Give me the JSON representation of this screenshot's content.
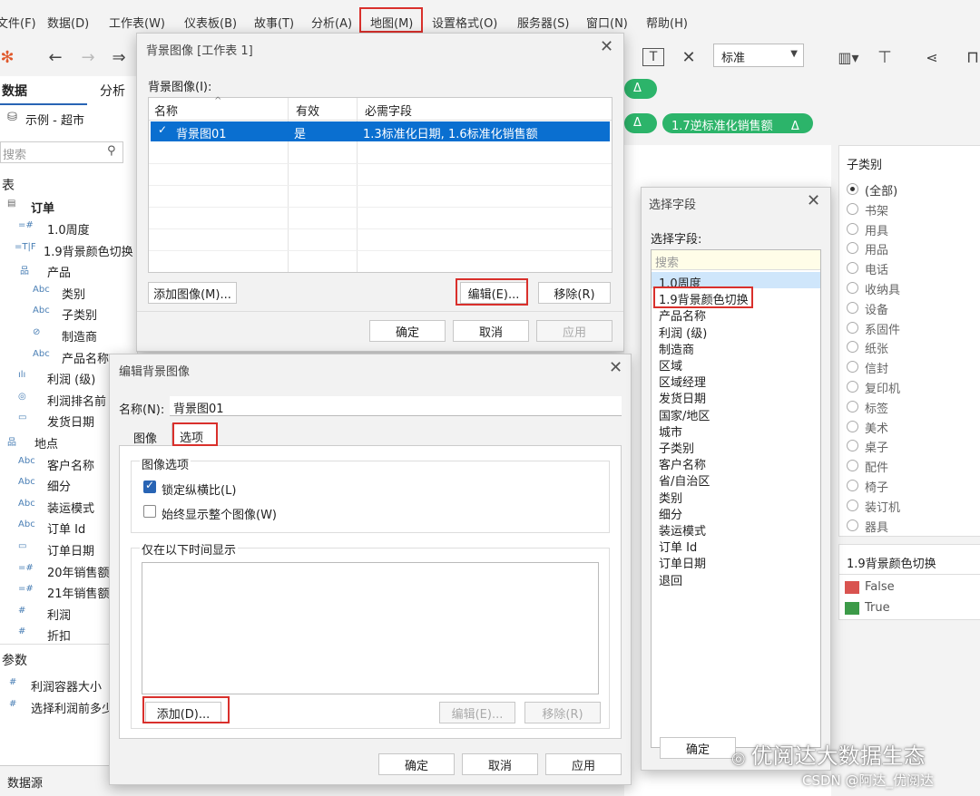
{
  "menu": [
    "文件(F)",
    "数据(D)",
    "工作表(W)",
    "仪表板(B)",
    "故事(T)",
    "分析(A)",
    "地图(M)",
    "设置格式(O)",
    "服务器(S)",
    "窗口(N)",
    "帮助(H)"
  ],
  "toolbar": {
    "select_value": "标准",
    "text_icon": "T"
  },
  "leftpane": {
    "tab_data": "数据",
    "tab_analysis": "分析",
    "datasource": "示例 - 超市",
    "search_placeholder": "搜索",
    "section_tables": "表",
    "table_name": "订单",
    "fields": [
      {
        "icon": "=#",
        "label": "1.0周度"
      },
      {
        "icon": "=T|F",
        "label": "1.9背景颜色切换"
      },
      {
        "icon": "品",
        "label": "产品"
      },
      {
        "icon": "Abc",
        "label": "类别"
      },
      {
        "icon": "Abc",
        "label": "子类别"
      },
      {
        "icon": "⊘",
        "label": "制造商"
      },
      {
        "icon": "Abc",
        "label": "产品名称"
      },
      {
        "icon": "ılı",
        "label": "利润 (级)"
      },
      {
        "icon": "◎",
        "label": "利润排名前"
      },
      {
        "icon": "▭",
        "label": "发货日期"
      },
      {
        "icon": "品",
        "label": "地点"
      },
      {
        "icon": "Abc",
        "label": "客户名称"
      },
      {
        "icon": "Abc",
        "label": "细分"
      },
      {
        "icon": "Abc",
        "label": "装运模式"
      },
      {
        "icon": "Abc",
        "label": "订单 Id"
      },
      {
        "icon": "▭",
        "label": "订单日期"
      },
      {
        "icon": "=#",
        "label": "20年销售额"
      },
      {
        "icon": "=#",
        "label": "21年销售额"
      },
      {
        "icon": "#",
        "label": "利润"
      },
      {
        "icon": "#",
        "label": "折扣"
      }
    ],
    "section_params": "参数",
    "params": [
      {
        "icon": "#",
        "label": "利润容器大小"
      },
      {
        "icon": "#",
        "label": "选择利润前多少"
      }
    ],
    "datasource_tab": "数据源"
  },
  "pills": {
    "pill1": "Δ",
    "pill2": "Δ",
    "pill3": "1.7逆标准化销售额",
    "pill3_delta": "Δ"
  },
  "subcat_panel": {
    "title": "子类别",
    "items": [
      "(全部)",
      "书架",
      "用具",
      "用品",
      "电话",
      "收纳具",
      "设备",
      "系固件",
      "纸张",
      "信封",
      "复印机",
      "标签",
      "美术",
      "桌子",
      "配件",
      "椅子",
      "装订机",
      "器具"
    ]
  },
  "color_panel": {
    "title": "1.9背景颜色切换",
    "items": [
      {
        "label": "False",
        "color": "#d9534f"
      },
      {
        "label": "True",
        "color": "#3c9a48"
      }
    ]
  },
  "bg_dialog": {
    "title": "背景图像 [工作表 1]",
    "list_label": "背景图像(I):",
    "col_name": "名称",
    "col_valid": "有效",
    "col_fields": "必需字段",
    "row": {
      "name": "背景图01",
      "valid": "是",
      "fields": "1.3标准化日期, 1.6标准化销售额"
    },
    "btn_add": "添加图像(M)...",
    "btn_edit": "编辑(E)...",
    "btn_remove": "移除(R)",
    "btn_ok": "确定",
    "btn_cancel": "取消",
    "btn_apply": "应用"
  },
  "edit_dialog": {
    "title": "编辑背景图像",
    "name_label": "名称(N):",
    "name_value": "背景图01",
    "tab_image": "图像",
    "tab_options": "选项",
    "group_image_options": "图像选项",
    "chk_lock": "锁定纵横比(L)",
    "chk_show_all": "始终显示整个图像(W)",
    "group_time": "仅在以下时间显示",
    "btn_add": "添加(D)...",
    "btn_edit": "编辑(E)...",
    "btn_remove": "移除(R)",
    "btn_ok": "确定",
    "btn_cancel": "取消",
    "btn_apply": "应用"
  },
  "field_dialog": {
    "title": "选择字段",
    "label": "选择字段:",
    "search_placeholder": "搜索",
    "items": [
      "1.0周度",
      "1.9背景颜色切换",
      "产品名称",
      "利润 (级)",
      "制造商",
      "区域",
      "区域经理",
      "发货日期",
      "国家/地区",
      "城市",
      "子类别",
      "客户名称",
      "省/自治区",
      "类别",
      "细分",
      "装运模式",
      "订单 Id",
      "订单日期",
      "退回"
    ],
    "btn_ok": "确定"
  },
  "watermark": {
    "brand": "优阅达大数据生态",
    "csdn": "CSDN @阿达_优阅达"
  }
}
